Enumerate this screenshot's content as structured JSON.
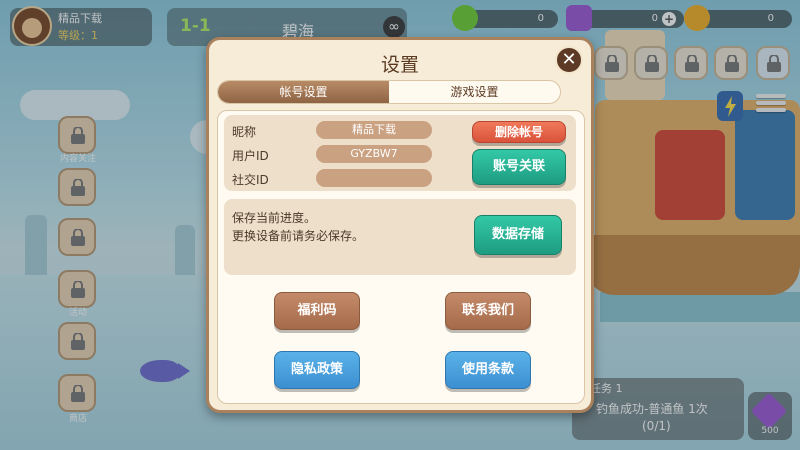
{
  "player": {
    "name": "精品下载",
    "level": "等级：1"
  },
  "stage": {
    "number": "1-1",
    "name": "碧海",
    "infinity_symbol": "∞"
  },
  "resources": [
    {
      "icon": "heart-icon",
      "value": "0",
      "color": "#6fcf3a"
    },
    {
      "icon": "purple-gem-icon",
      "value": "0",
      "color": "#9b5bd6"
    },
    {
      "icon": "gold-star-icon",
      "value": "0",
      "color": "#f2b02a"
    }
  ],
  "sidebar": {
    "labels": [
      "内容关注",
      "",
      "",
      "活动",
      "",
      "商店"
    ]
  },
  "task": {
    "title": "任务 1",
    "description": "钓鱼成功-普通鱼 1次",
    "progress": "(0/1)"
  },
  "gem_counter": {
    "value": "500"
  },
  "dialog": {
    "title": "设置",
    "close_symbol": "✕",
    "tabs": [
      "帐号设置",
      "游戏设置"
    ],
    "account": {
      "nickname_label": "昵称",
      "nickname_value": "精品下载",
      "userid_label": "用户ID",
      "userid_value": "GYZBW7",
      "social_label": "社交ID",
      "social_value": "",
      "delete_button": "删除帐号",
      "link_button": "账号关联"
    },
    "save": {
      "line1": "保存当前进度。",
      "line2": "更换设备前请务必保存。",
      "button": "数据存储"
    },
    "buttons": {
      "gift_code": "福利码",
      "contact": "联系我们",
      "privacy": "隐私政策",
      "terms": "使用条款"
    }
  }
}
